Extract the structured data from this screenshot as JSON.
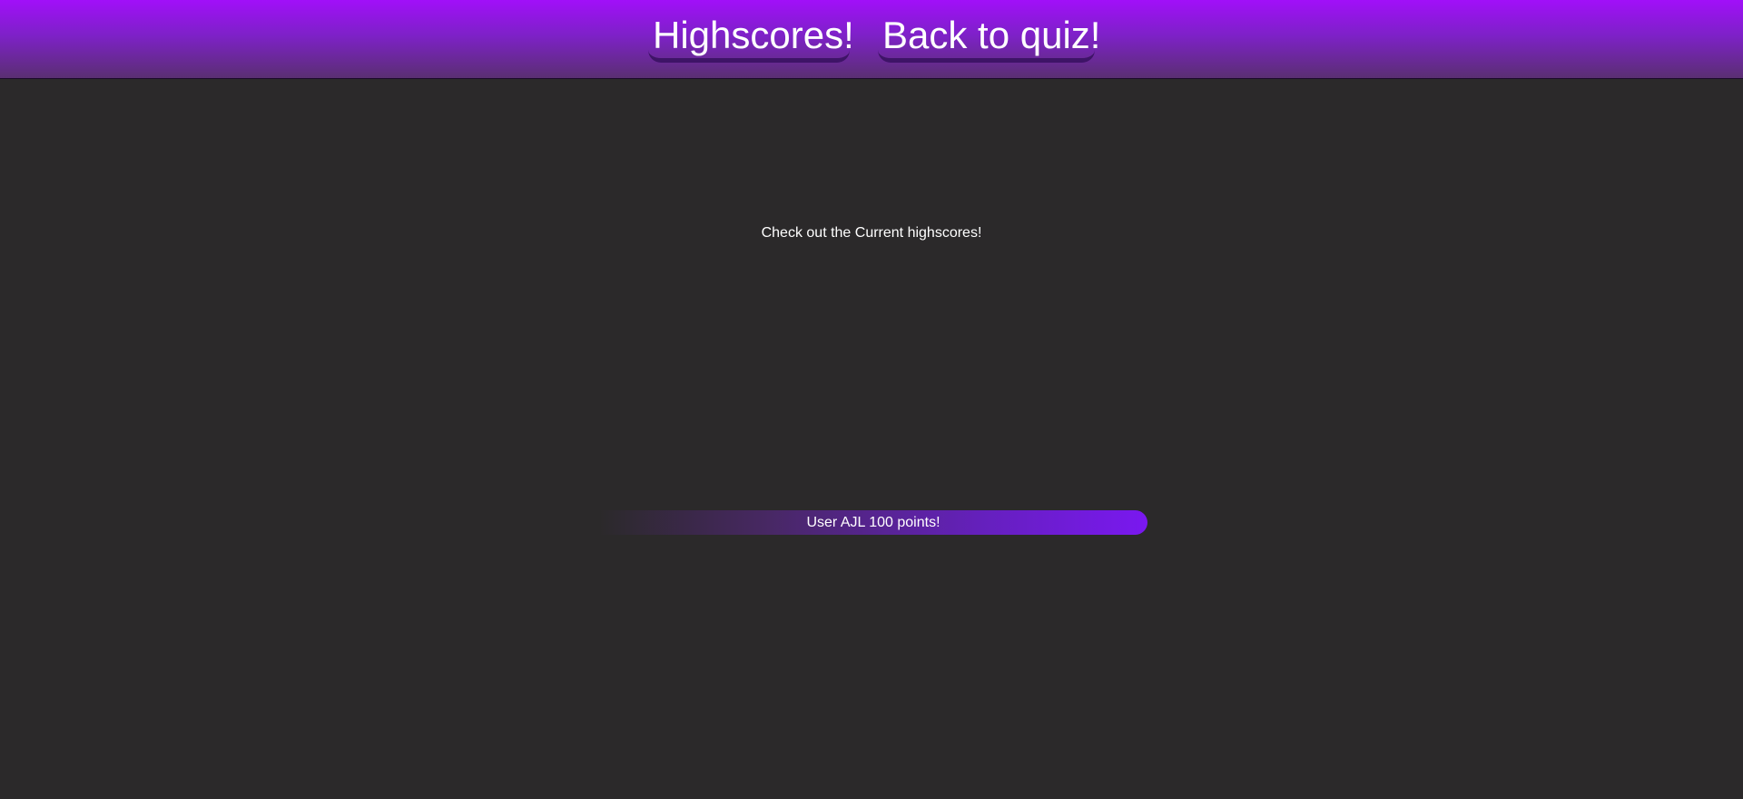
{
  "header": {
    "nav": {
      "highscores_label": "Highscores!",
      "back_to_quiz_label": "Back to quiz!"
    }
  },
  "main": {
    "heading": "Check out the Current highscores!",
    "scores": [
      {
        "text": "User AJL 100 points!"
      }
    ]
  },
  "colors": {
    "background": "#2b292a",
    "header_gradient_top": "#a10ff9",
    "header_gradient_bottom": "#5a2f72",
    "accent": "#7a18f0",
    "text": "#ffffff"
  }
}
